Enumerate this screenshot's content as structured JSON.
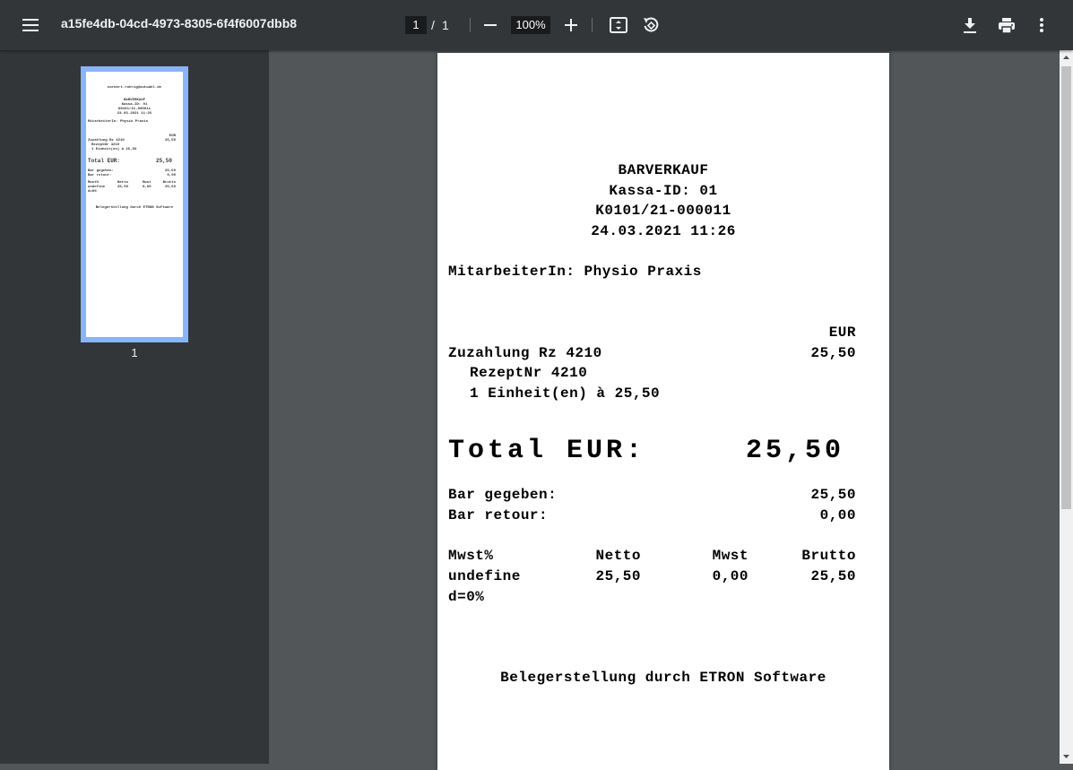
{
  "toolbar": {
    "title": "a15fe4db-04cd-4973-8305-6f4f6007dbb8",
    "page_current": "1",
    "page_separator": "/",
    "page_total": "1",
    "zoom": "100%"
  },
  "sidebar": {
    "thumbnail_label": "1",
    "thumbnail_lines": [
      "norbert.rohrig@outwahl.de",
      "BARVERKAUF",
      "Kassa-ID: 01",
      "K0101/21-000011",
      "24.03.2021 11:26",
      "MitarbeiterIn: Physio Praxis",
      "EUR",
      "Zuzahlung Rz 4210",
      "25,50",
      "RezeptNr 4210",
      "1 Einheit(en) à 25,50",
      "Total EUR:",
      "25,50",
      "Bar gegeben:",
      "25,50",
      "Bar retour:",
      "0,00",
      "Mwst%",
      "Netto",
      "Mwst",
      "Brutto",
      "undefine",
      "25,50",
      "0,00",
      "25,50",
      "d=0%",
      "Belegerstellung durch ETRON Software"
    ]
  },
  "receipt": {
    "heading": "BARVERKAUF",
    "kassa_id": "Kassa-ID: 01",
    "receipt_no": "K0101/21-000011",
    "datetime": "24.03.2021 11:26",
    "employee": "MitarbeiterIn: Physio Praxis",
    "currency_header": "EUR",
    "item_name": "Zuzahlung Rz 4210",
    "item_amount": "25,50",
    "item_detail_1": "RezeptNr 4210",
    "item_detail_2": "1 Einheit(en) à 25,50",
    "total_label": "Total EUR:",
    "total_amount": "25,50",
    "paid_label": "Bar gegeben:",
    "paid_amount": "25,50",
    "change_label": "Bar retour:",
    "change_amount": "0,00",
    "tax_headers": [
      "Mwst%",
      "Netto",
      "Mwst",
      "Brutto"
    ],
    "tax_row": [
      "undefine",
      "25,50",
      "0,00",
      "25,50"
    ],
    "tax_row_cont": "d=0%",
    "footer": "Belegerstellung durch ETRON Software"
  }
}
